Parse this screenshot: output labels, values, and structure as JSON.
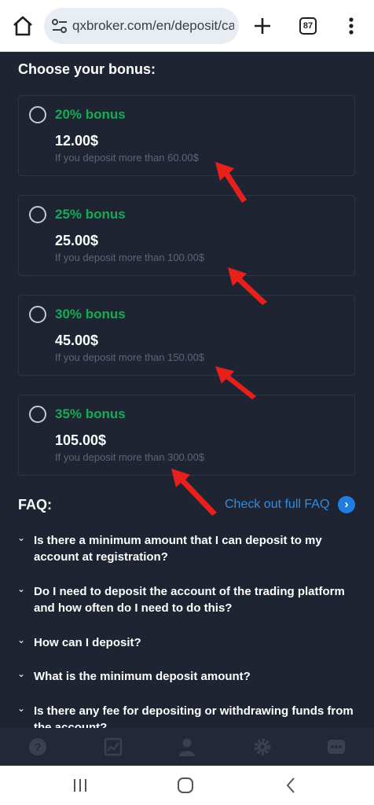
{
  "browser": {
    "url": "qxbroker.com/en/deposit/ca",
    "tab_count": "87"
  },
  "bonus_section": {
    "title": "Choose your bonus:",
    "options": [
      {
        "label": "20% bonus",
        "amount": "12.00$",
        "note": "If you deposit more than 60.00$"
      },
      {
        "label": "25% bonus",
        "amount": "25.00$",
        "note": "If you deposit more than 100.00$"
      },
      {
        "label": "30% bonus",
        "amount": "45.00$",
        "note": "If you deposit more than 150.00$"
      },
      {
        "label": "35% bonus",
        "amount": "105.00$",
        "note": "If you deposit more than 300.00$"
      }
    ]
  },
  "faq": {
    "title": "FAQ:",
    "link_label": "Check out full FAQ",
    "items": [
      "Is there a minimum amount that I can deposit to my account at registration?",
      "Do I need to deposit the account of the trading platform and how often do I need to do this?",
      "How can I deposit?",
      "What is the minimum deposit amount?",
      "Is there any fee for depositing or withdrawing funds from the account?"
    ]
  },
  "bottom_nav": [
    "help-icon",
    "chart-icon",
    "user-icon",
    "gear-icon",
    "chat-icon"
  ],
  "colors": {
    "background": "#1f2433",
    "bonus_green": "#18a957",
    "link_blue": "#2f8de4",
    "annotation_red": "#e8201c"
  }
}
